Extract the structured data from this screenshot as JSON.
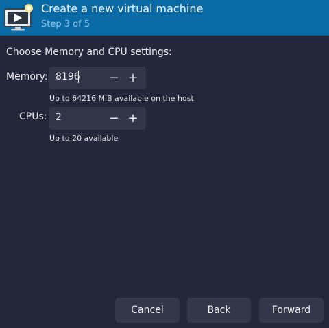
{
  "header": {
    "title": "Create a new virtual machine",
    "step": "Step 3 of 5",
    "icon": "virtual-machine-icon",
    "accent_color": "#0a6aa6"
  },
  "content": {
    "section_label": "Choose Memory and CPU settings:",
    "memory": {
      "label": "Memory:",
      "value": "8196",
      "hint": "Up to 64216 MiB available on the host"
    },
    "cpus": {
      "label": "CPUs:",
      "value": "2",
      "hint": "Up to 20 available"
    },
    "decrement_symbol": "−",
    "increment_symbol": "+"
  },
  "buttons": {
    "cancel": "Cancel",
    "back": "Back",
    "forward": "Forward"
  }
}
